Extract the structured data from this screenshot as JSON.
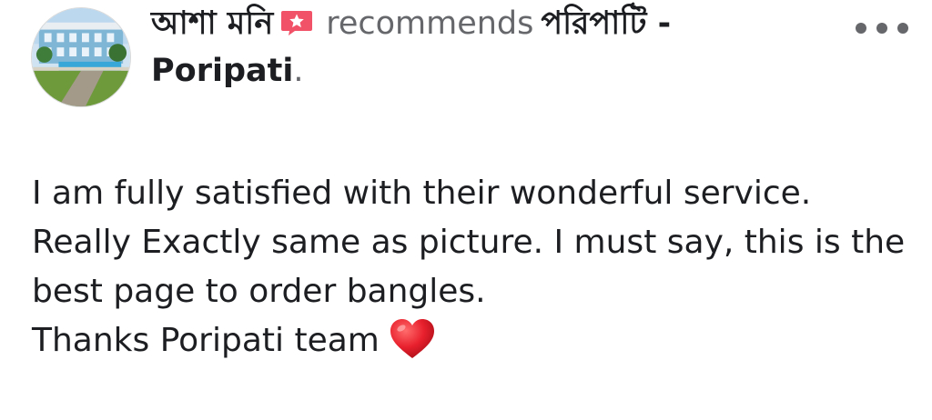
{
  "post": {
    "author_name": "আশা মনি",
    "verb": "recommends",
    "page_name": "পরিপাটি - Poripati",
    "period": ".",
    "recommend_icon": "recommend-star-icon",
    "more_icon": "more-options-icon",
    "heart_icon": "red-heart-emoji",
    "body_lines": [
      "I am fully satisfied with their wonderful service.",
      "Really Exactly same as picture. I must say, this is the best page to order bangles.",
      "Thanks Poripati team"
    ],
    "colors": {
      "recommend_icon": "#f25268",
      "heart": "#e8202d",
      "secondary_text": "#65676b"
    }
  }
}
